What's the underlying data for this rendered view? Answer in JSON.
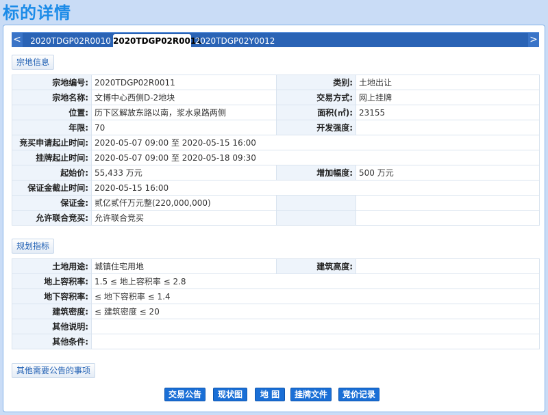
{
  "page": {
    "title": "标的详情"
  },
  "tabs": [
    {
      "label": "2020TDGP02R0010"
    },
    {
      "label": "2020TDGP02R0011"
    },
    {
      "label": "2020TDGP02Y0012"
    }
  ],
  "nav": {
    "prev": "<",
    "next": ">"
  },
  "sections": {
    "parcel": "宗地信息",
    "planning": "规划指标",
    "other": "其他需要公告的事项"
  },
  "parcel": {
    "code_label": "宗地编号:",
    "code": "2020TDGP02R0011",
    "category_label": "类别:",
    "category": "土地出让",
    "name_label": "宗地名称:",
    "name": "文博中心西侧D-2地块",
    "trade_label": "交易方式:",
    "trade": "网上挂牌",
    "location_label": "位置:",
    "location": "历下区解放东路以南，浆水泉路两侧",
    "area_label": "面积(㎡):",
    "area": "23155",
    "years_label": "年限:",
    "years": "70",
    "intensity_label": "开发强度:",
    "intensity": "",
    "bid_period_label": "竞买申请起止时间:",
    "bid_period": "2020-05-07 09:00 至 2020-05-15 16:00",
    "listing_period_label": "挂牌起止时间:",
    "listing_period": "2020-05-07 09:00 至 2020-05-18 09:30",
    "start_price_label": "起始价:",
    "start_price": "55,433 万元",
    "increment_label": "增加幅度:",
    "increment": "500 万元",
    "deposit_deadline_label": "保证金截止时间:",
    "deposit_deadline": "2020-05-15 16:00",
    "deposit_label": "保证金:",
    "deposit": "贰亿贰仟万元整(220,000,000)",
    "joint_label": "允许联合竞买:",
    "joint": "允许联合竞买"
  },
  "planning": {
    "land_use_label": "土地用途:",
    "land_use": "城镇住宅用地",
    "height_label": "建筑高度:",
    "height": "",
    "far_above_label": "地上容积率:",
    "far_above": "1.5 ≤ 地上容积率 ≤ 2.8",
    "far_below_label": "地下容积率:",
    "far_below": "≤ 地下容积率 ≤ 1.4",
    "density_label": "建筑密度:",
    "density": "≤ 建筑密度 ≤ 20",
    "notes_label": "其他说明:",
    "notes": "",
    "conditions_label": "其他条件:",
    "conditions": ""
  },
  "buttons": {
    "announcement": "交易公告",
    "status_map": "现状图",
    "map": "地 图",
    "listing_docs": "挂牌文件",
    "bid_records": "竞价记录"
  }
}
